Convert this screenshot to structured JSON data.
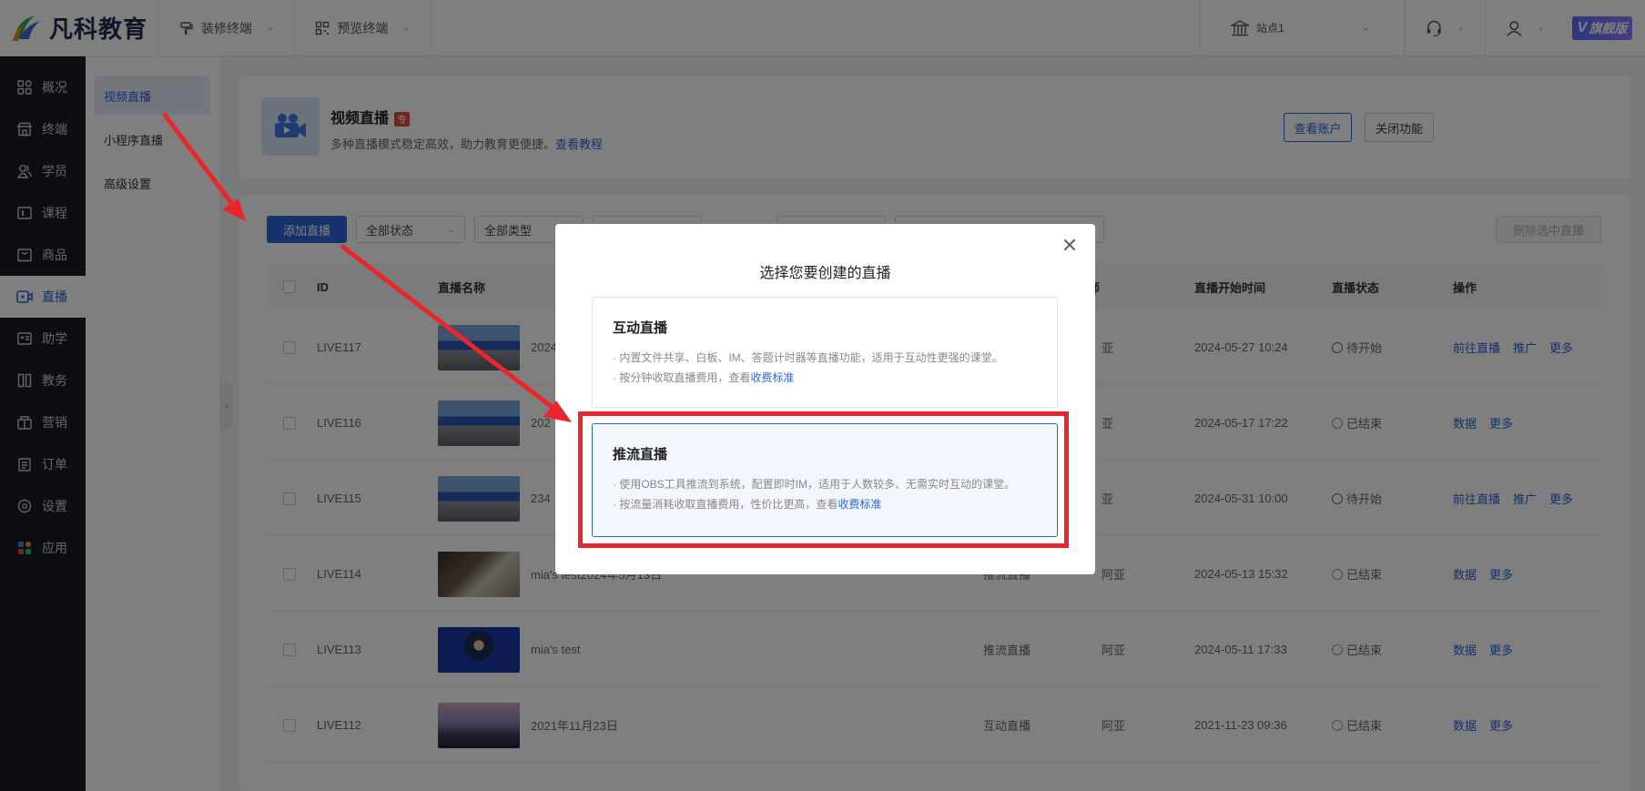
{
  "topbar": {
    "logo_text": "凡科教育",
    "decor_terminal": "装修终端",
    "preview_terminal": "预览终端",
    "site": "站点1",
    "vip_badge": "旗舰版"
  },
  "leftnav": {
    "items": [
      {
        "label": "概况",
        "icon": "grid-icon"
      },
      {
        "label": "终端",
        "icon": "store-icon"
      },
      {
        "label": "学员",
        "icon": "users-icon"
      },
      {
        "label": "课程",
        "icon": "course-icon"
      },
      {
        "label": "商品",
        "icon": "bag-icon"
      },
      {
        "label": "直播",
        "icon": "live-icon",
        "active": true
      },
      {
        "label": "助学",
        "icon": "assist-icon"
      },
      {
        "label": "教务",
        "icon": "books-icon"
      },
      {
        "label": "营销",
        "icon": "marketing-icon"
      },
      {
        "label": "订单",
        "icon": "order-icon"
      },
      {
        "label": "设置",
        "icon": "settings-icon"
      },
      {
        "label": "应用",
        "icon": "apps-icon"
      }
    ]
  },
  "subnav": {
    "items": [
      {
        "label": "视频直播",
        "active": true
      },
      {
        "label": "小程序直播"
      },
      {
        "label": "高级设置"
      }
    ]
  },
  "header": {
    "title": "视频直播",
    "badge": "专",
    "desc": "多种直播模式稳定高效，助力教育更便捷。",
    "tutorial_link": "查看教程",
    "view_account": "查看账户",
    "close_feature": "关闭功能"
  },
  "toolbar": {
    "add_live": "添加直播",
    "status_filter": "全部状态",
    "type_filter": "全部类型",
    "delete_selected": "删除选中直播"
  },
  "table": {
    "columns": [
      "ID",
      "直播名称",
      "师",
      "直播开始时间",
      "直播状态",
      "操作"
    ],
    "rows": [
      {
        "id": "LIVE117",
        "name": "2024",
        "type": "",
        "teacher": "亚",
        "start": "2024-05-27 10:24",
        "status": "待开始",
        "ops": [
          "前往直播",
          "推广",
          "更多"
        ],
        "thumb": "building"
      },
      {
        "id": "LIVE116",
        "name": "202",
        "type": "",
        "teacher": "亚",
        "start": "2024-05-17 17:22",
        "status": "已结束",
        "ops": [
          "数据",
          "更多"
        ],
        "thumb": "building"
      },
      {
        "id": "LIVE115",
        "name": "234",
        "type": "",
        "teacher": "亚",
        "start": "2024-05-31 10:00",
        "status": "待开始",
        "ops": [
          "前往直播",
          "推广",
          "更多"
        ],
        "thumb": "building"
      },
      {
        "id": "LIVE114",
        "name": "mia's test2024年5月13日",
        "type": "推流直播",
        "teacher": "阿亚",
        "start": "2024-05-13 15:32",
        "status": "已结束",
        "ops": [
          "数据",
          "更多"
        ],
        "thumb": "desk"
      },
      {
        "id": "LIVE113",
        "name": "mia's test",
        "type": "推流直播",
        "teacher": "阿亚",
        "start": "2024-05-11 17:33",
        "status": "已结束",
        "ops": [
          "数据",
          "更多"
        ],
        "thumb": "speaker"
      },
      {
        "id": "LIVE112",
        "name": "2021年11月23日",
        "type": "互动直播",
        "teacher": "阿亚",
        "start": "2021-11-23 09:36",
        "status": "已结束",
        "ops": [
          "数据",
          "更多"
        ],
        "thumb": "city"
      }
    ]
  },
  "modal": {
    "title": "选择您要创建的直播",
    "options": [
      {
        "title": "互动直播",
        "line1": "· 内置文件共享、白板、IM、答题计时器等直播功能，适用于互动性更强的课堂。",
        "line2": "· 按分钟收取直播费用，查看",
        "link": "收费标准"
      },
      {
        "title": "推流直播",
        "line1": "· 使用OBS工具推流到系统，配置即时IM，适用于人数较多、无需实时互动的课堂。",
        "line2": "· 按流量消耗收取直播费用，性价比更高，查看",
        "link": "收费标准"
      }
    ]
  },
  "colors": {
    "primary": "#2a64d6",
    "annotation_red": "#e8262b"
  }
}
